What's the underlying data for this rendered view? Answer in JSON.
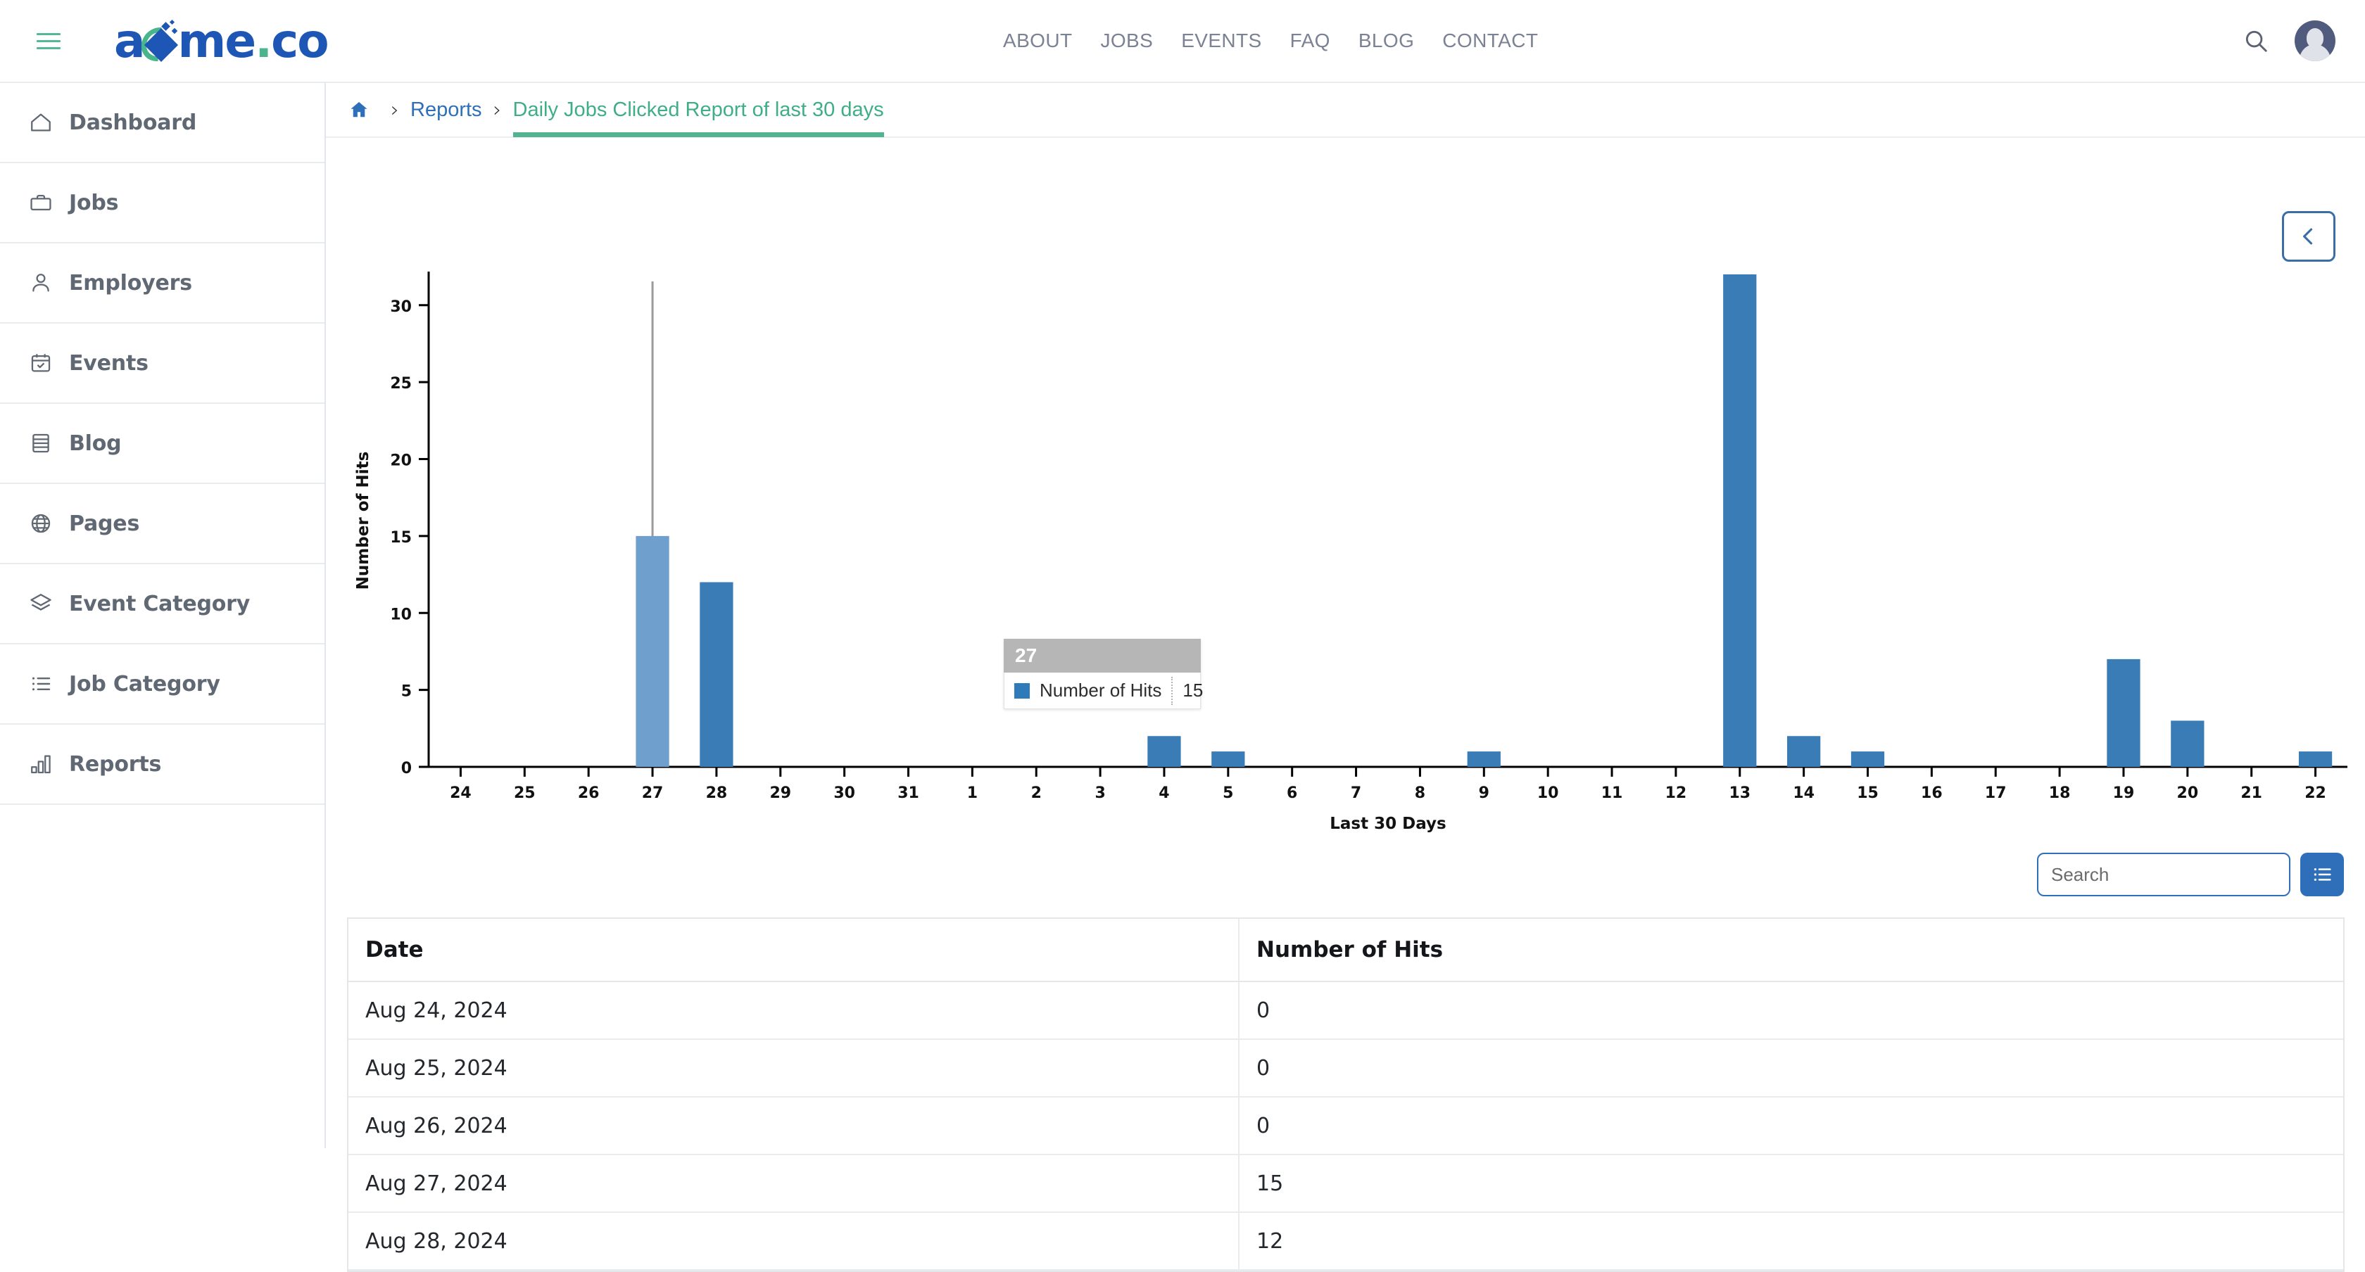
{
  "header": {
    "logo_text_before": "a",
    "logo_text_after": "me",
    "logo_dot": ".",
    "logo_tld": "co",
    "nav": [
      {
        "label": "ABOUT"
      },
      {
        "label": "JOBS"
      },
      {
        "label": "EVENTS"
      },
      {
        "label": "FAQ"
      },
      {
        "label": "BLOG"
      },
      {
        "label": "CONTACT"
      }
    ],
    "search_icon": "search-icon",
    "avatar_icon": "user-avatar",
    "menu_icon": "hamburger-menu-icon"
  },
  "sidebar": {
    "items": [
      {
        "label": "Dashboard",
        "icon": "home-icon"
      },
      {
        "label": "Jobs",
        "icon": "briefcase-icon"
      },
      {
        "label": "Employers",
        "icon": "person-icon"
      },
      {
        "label": "Events",
        "icon": "calendar-check-icon"
      },
      {
        "label": "Blog",
        "icon": "book-icon"
      },
      {
        "label": "Pages",
        "icon": "globe-icon"
      },
      {
        "label": "Event Category",
        "icon": "layers-icon"
      },
      {
        "label": "Job Category",
        "icon": "list-icon"
      },
      {
        "label": "Reports",
        "icon": "bar-chart-icon"
      }
    ]
  },
  "breadcrumb": {
    "home_icon": "home-icon",
    "separator": "›",
    "items": [
      {
        "label": "Reports",
        "active": false
      },
      {
        "label": "Daily Jobs Clicked Report of last 30 days",
        "active": true
      }
    ]
  },
  "panel": {
    "collapse_button_icon": "chevron-left-icon"
  },
  "tooltip": {
    "title": "27",
    "series_label": "Number of Hits",
    "value": "15",
    "swatch_color": "#2f7ab8"
  },
  "search": {
    "placeholder": "Search",
    "value": "",
    "list_button_icon": "list-icon"
  },
  "table": {
    "columns": [
      "Date",
      "Number of Hits"
    ],
    "rows": [
      {
        "date": "Aug 24, 2024",
        "hits": "0"
      },
      {
        "date": "Aug 25, 2024",
        "hits": "0"
      },
      {
        "date": "Aug 26, 2024",
        "hits": "0"
      },
      {
        "date": "Aug 27, 2024",
        "hits": "15"
      },
      {
        "date": "Aug 28, 2024",
        "hits": "12"
      }
    ]
  },
  "colors": {
    "bar": "#3a7cb5",
    "bar_highlight": "#6f9fcd",
    "accent_blue": "#2f6fba",
    "accent_green": "#52b48e",
    "logo_blue": "#1d56b5",
    "sidebar_text": "#606873"
  },
  "chart_data": {
    "type": "bar",
    "title": "",
    "xlabel": "Last 30 Days",
    "ylabel": "Number of Hits",
    "ylim": [
      0,
      32
    ],
    "yticks": [
      0,
      5,
      10,
      15,
      20,
      25,
      30
    ],
    "grid": false,
    "legend": [
      "Number of Hits"
    ],
    "categories": [
      "24",
      "25",
      "26",
      "27",
      "28",
      "29",
      "30",
      "31",
      "1",
      "2",
      "3",
      "4",
      "5",
      "6",
      "7",
      "8",
      "9",
      "10",
      "11",
      "12",
      "13",
      "14",
      "15",
      "16",
      "17",
      "18",
      "19",
      "20",
      "21",
      "22"
    ],
    "values": [
      0,
      0,
      0,
      15,
      12,
      0,
      0,
      0,
      0,
      0,
      0,
      2,
      1,
      0,
      0,
      0,
      1,
      0,
      0,
      0,
      32,
      2,
      1,
      0,
      0,
      0,
      7,
      3,
      0,
      1
    ],
    "highlighted_index": 3,
    "crosshair_category": "27"
  }
}
